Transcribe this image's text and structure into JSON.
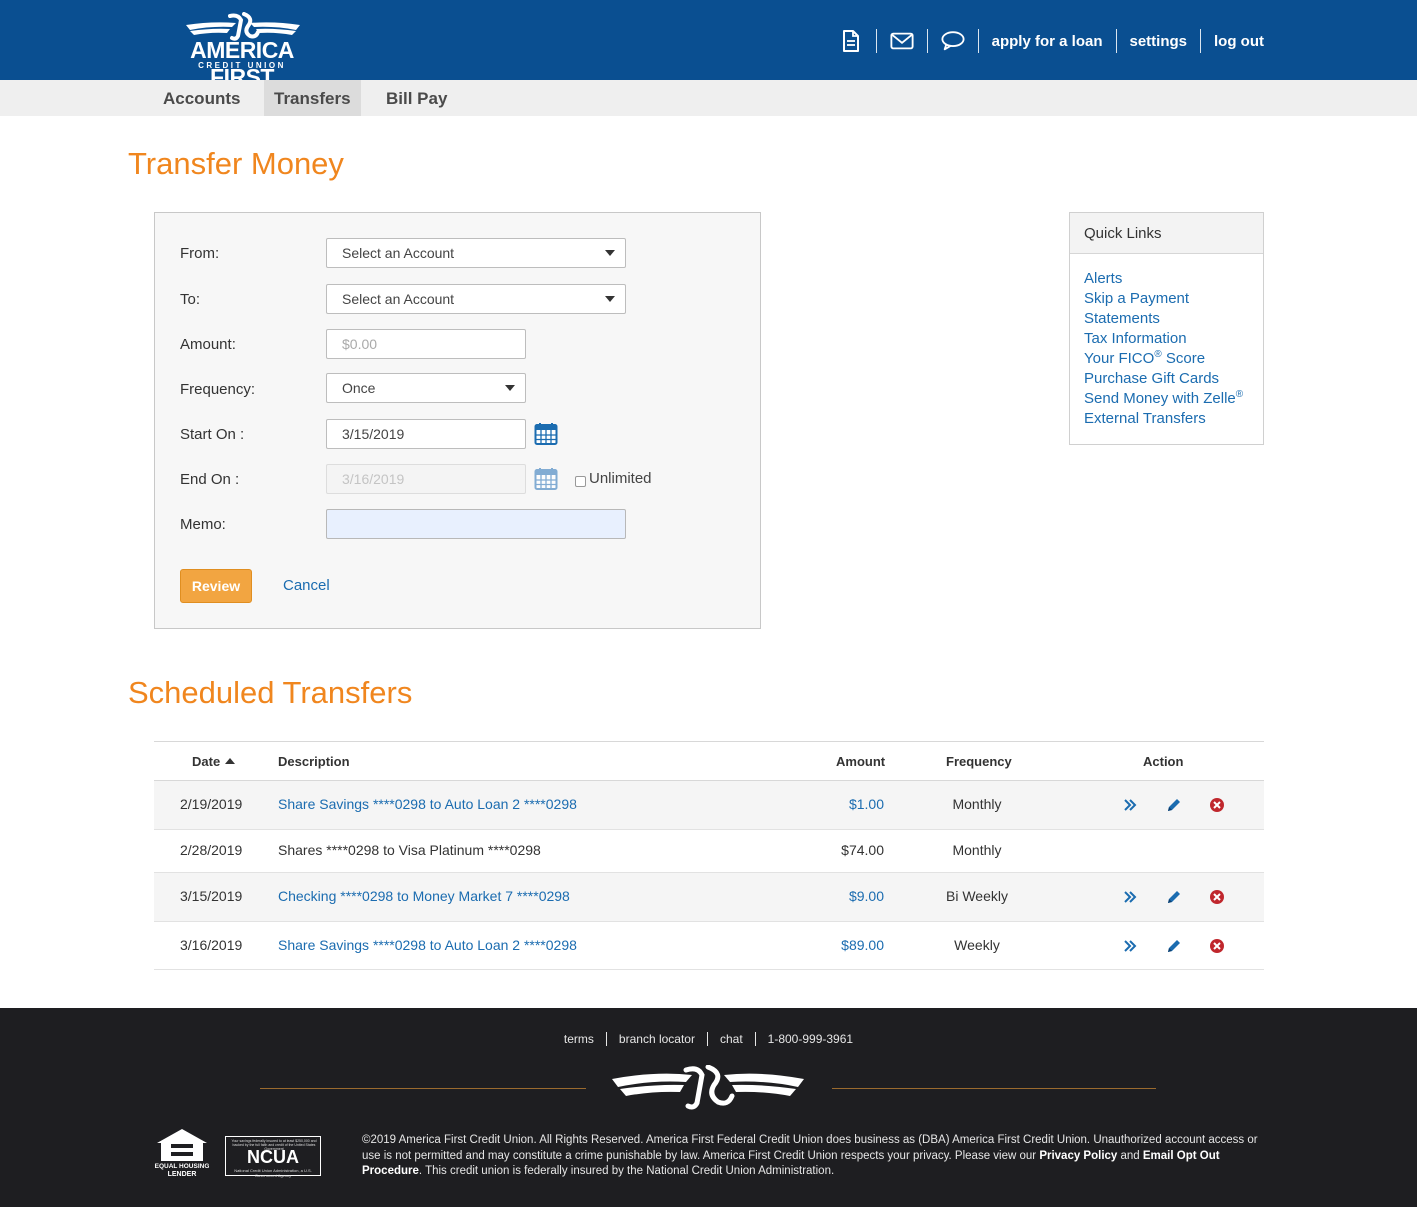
{
  "brand": {
    "name": "AMERICA FIRST",
    "sub": "CREDIT UNION"
  },
  "top_nav": {
    "apply_label": "apply for a loan",
    "settings_label": "settings",
    "logout_label": "log out"
  },
  "sub_nav": {
    "tabs": [
      {
        "label": "Accounts"
      },
      {
        "label": "Transfers",
        "active": true
      },
      {
        "label": "Bill Pay"
      }
    ]
  },
  "page_title": "Transfer Money",
  "form": {
    "from_label": "From:",
    "from_value": "Select an Account",
    "to_label": "To:",
    "to_value": "Select an Account",
    "amount_label": "Amount:",
    "amount_placeholder": "$0.00",
    "frequency_label": "Frequency:",
    "frequency_value": "Once",
    "start_label": "Start On :",
    "start_value": "3/15/2019",
    "end_label": "End On :",
    "end_value": "3/16/2019",
    "unlimited_label": "Unlimited",
    "memo_label": "Memo:",
    "memo_value": "",
    "review_label": "Review",
    "cancel_label": "Cancel"
  },
  "quick_links": {
    "title": "Quick Links",
    "items": [
      {
        "label": "Alerts"
      },
      {
        "label": "Skip a Payment"
      },
      {
        "label": "Statements"
      },
      {
        "label": "Tax Information"
      },
      {
        "label": "Your FICO",
        "sup": "®",
        "rest": " Score"
      },
      {
        "label": "Purchase Gift Cards"
      },
      {
        "label": "Send Money with Zelle",
        "sup": "®",
        "rest": ""
      },
      {
        "label": "External Transfers"
      }
    ]
  },
  "scheduled": {
    "title": "Scheduled Transfers",
    "headers": {
      "date": "Date",
      "description": "Description",
      "amount": "Amount",
      "frequency": "Frequency",
      "action": "Action"
    },
    "rows": [
      {
        "date": "2/19/2019",
        "description": "Share Savings ****0298 to Auto Loan 2 ****0298",
        "amount": "$1.00",
        "frequency": "Monthly",
        "editable": true
      },
      {
        "date": "2/28/2019",
        "description": "Shares ****0298 to Visa Platinum ****0298",
        "amount": "$74.00",
        "frequency": "Monthly",
        "editable": false
      },
      {
        "date": "3/15/2019",
        "description": "Checking ****0298 to Money Market 7 ****0298",
        "amount": "$9.00",
        "frequency": "Bi Weekly",
        "editable": true
      },
      {
        "date": "3/16/2019",
        "description": "Share Savings ****0298 to Auto Loan 2 ****0298",
        "amount": "$89.00",
        "frequency": "Weekly",
        "editable": true
      }
    ]
  },
  "footer": {
    "links": [
      "terms",
      "branch locator",
      "chat",
      "1-800-999-3961"
    ],
    "equal_housing": "EQUAL HOUSING LENDER",
    "ncua": "NCUA",
    "ncua_fine_print": "Your savings federally insured to at least $250,000 and backed by the full faith and credit of the United States Government",
    "ncua_sub": "National Credit Union Administration, a U.S. Government Agency",
    "legal_1": "©2019 America First Credit Union. All Rights Reserved. America First Federal Credit Union does business as (DBA) America First Credit Union. Unauthorized account access or use is not permitted and may constitute a crime punishable by law. America First Credit Union respects your privacy. Please view our ",
    "privacy": "Privacy Policy",
    "legal_and": " and ",
    "optout": "Email Opt Out Procedure",
    "legal_2": ". This credit union is federally insured by the National Credit Union Administration."
  },
  "colors": {
    "header_blue": "#0a4f91",
    "accent_orange": "#f0861e",
    "link_blue": "#1b6cb0",
    "review_button": "#f2a541",
    "footer_bg": "#1e1e21"
  },
  "icons": [
    "document-icon",
    "mail-icon",
    "chat-icon",
    "calendar-icon",
    "skip-icon",
    "edit-icon",
    "delete-icon"
  ]
}
